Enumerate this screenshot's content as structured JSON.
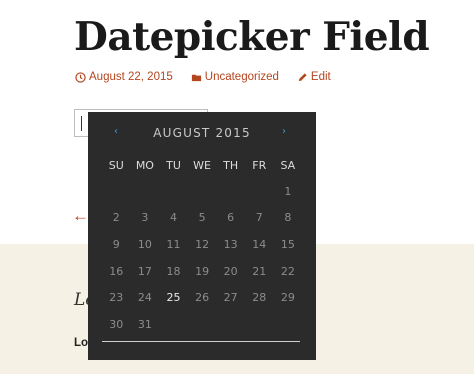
{
  "post": {
    "title": "Datepicker Field",
    "meta": {
      "date": "August 22, 2015",
      "category": "Uncategorized",
      "edit": "Edit"
    }
  },
  "footer": {
    "nav_arrow": "←",
    "heading": "Le",
    "text": "Lo"
  },
  "datepicker": {
    "prev": "‹",
    "next": "›",
    "month_year": "AUGUST 2015",
    "weekdays": [
      "SU",
      "MO",
      "TU",
      "WE",
      "TH",
      "FR",
      "SA"
    ],
    "weeks": [
      [
        "",
        "",
        "",
        "",
        "",
        "",
        "1"
      ],
      [
        "2",
        "3",
        "4",
        "5",
        "6",
        "7",
        "8"
      ],
      [
        "9",
        "10",
        "11",
        "12",
        "13",
        "14",
        "15"
      ],
      [
        "16",
        "17",
        "18",
        "19",
        "20",
        "21",
        "22"
      ],
      [
        "23",
        "24",
        "25",
        "26",
        "27",
        "28",
        "29"
      ],
      [
        "30",
        "31",
        "",
        "",
        "",
        "",
        ""
      ]
    ],
    "today": "25"
  },
  "colors": {
    "accent": "#b3451f",
    "nav": "#3a9bd6",
    "calendar_bg": "#2b2b2b",
    "band_bg": "#f5f1e4"
  }
}
